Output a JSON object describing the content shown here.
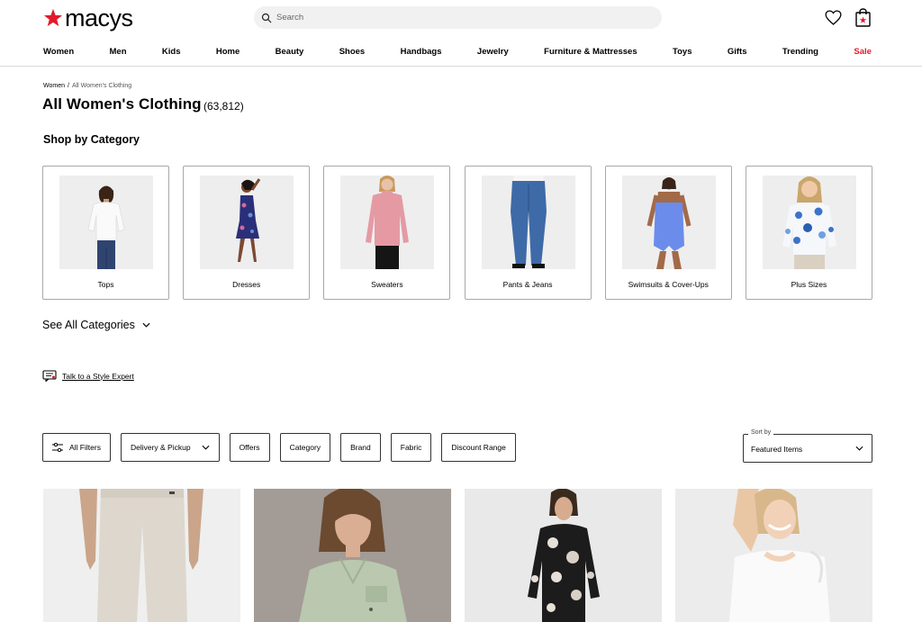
{
  "header": {
    "logo_text": "macys",
    "brand_color": "#e21a2c",
    "search_placeholder": "Search"
  },
  "nav": [
    {
      "label": "Women"
    },
    {
      "label": "Men"
    },
    {
      "label": "Kids"
    },
    {
      "label": "Home"
    },
    {
      "label": "Beauty"
    },
    {
      "label": "Shoes"
    },
    {
      "label": "Handbags"
    },
    {
      "label": "Jewelry"
    },
    {
      "label": "Furniture & Mattresses"
    },
    {
      "label": "Toys"
    },
    {
      "label": "Gifts"
    },
    {
      "label": "Trending"
    },
    {
      "label": "Sale"
    }
  ],
  "breadcrumb": {
    "parent": "Women",
    "separator": "/",
    "current": "All Women's Clothing"
  },
  "page": {
    "title": "All Women's Clothing",
    "count": "(63,812)"
  },
  "categories_section": {
    "heading": "Shop by Category",
    "items": [
      {
        "label": "Tops"
      },
      {
        "label": "Dresses"
      },
      {
        "label": "Sweaters"
      },
      {
        "label": "Pants & Jeans"
      },
      {
        "label": "Swimsuits & Cover-Ups"
      },
      {
        "label": "Plus Sizes"
      }
    ],
    "see_all": "See All Categories"
  },
  "style_expert": {
    "label": "Talk to a Style Expert"
  },
  "filters": {
    "all_filters": "All Filters",
    "delivery": "Delivery & Pickup",
    "offers": "Offers",
    "category": "Category",
    "brand": "Brand",
    "fabric": "Fabric",
    "discount": "Discount Range"
  },
  "sort": {
    "label": "Sort by",
    "value": "Featured Items"
  }
}
